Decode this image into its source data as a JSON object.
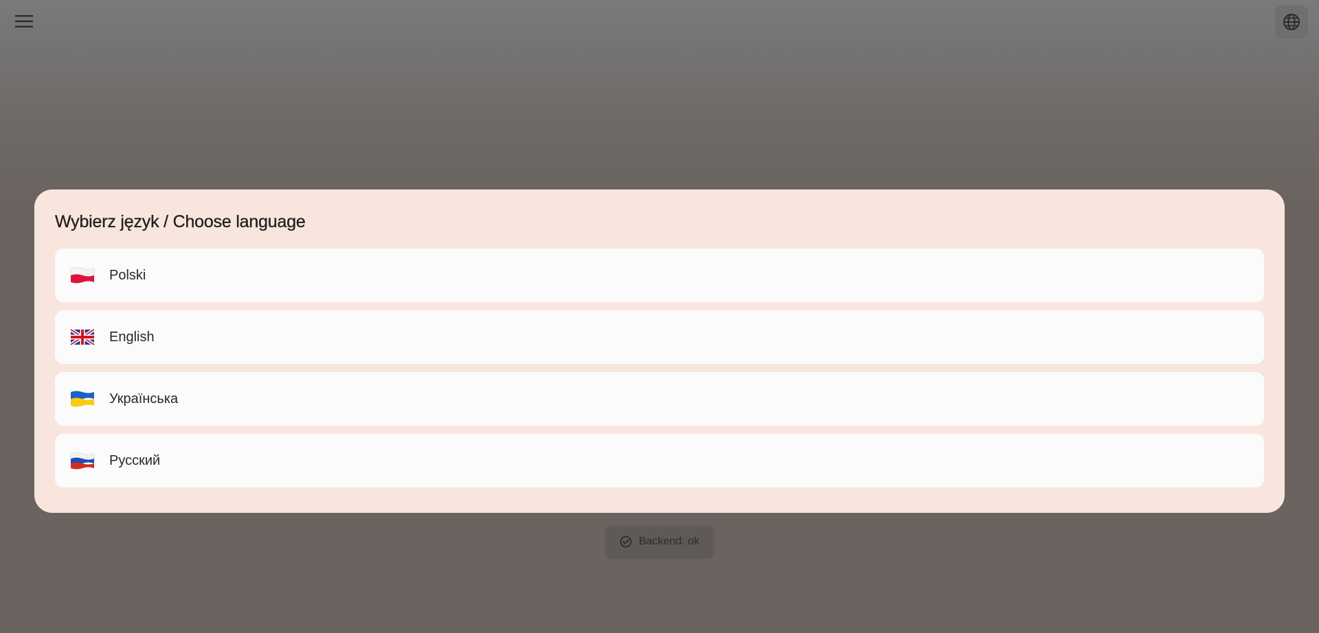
{
  "topbar": {
    "menu_icon": "hamburger-menu-icon",
    "language_icon": "globe-icon"
  },
  "dialog": {
    "title": "Wybierz język / Choose language",
    "languages": [
      {
        "label": "Polski",
        "flag": "flag-pl-icon"
      },
      {
        "label": "English",
        "flag": "flag-gb-icon"
      },
      {
        "label": "Українська",
        "flag": "flag-ua-icon"
      },
      {
        "label": "Русский",
        "flag": "flag-ru-icon"
      }
    ]
  },
  "status": {
    "text": "Backend: ok",
    "icon": "check-circle-icon"
  },
  "colors": {
    "dialog_bg": "#f8e6de",
    "item_bg": "#fbfbfb",
    "overlay": "#6a635f"
  }
}
